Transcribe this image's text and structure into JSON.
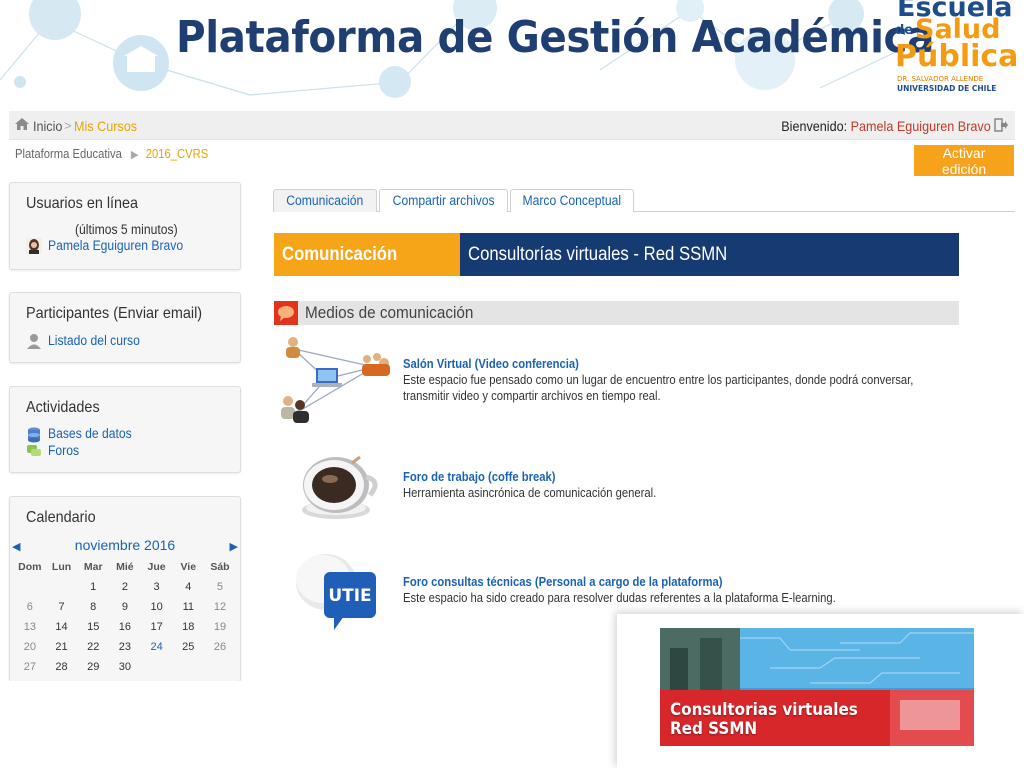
{
  "banner": {
    "title": "Plataforma de Gestión Académica"
  },
  "logo": {
    "escuela": "Escuela",
    "de": "de",
    "salud": "Salud",
    "publica": "Pública",
    "sub1": "DR. SALVADOR ALLENDE",
    "sub2": "UNIVERSIDAD DE CHILE"
  },
  "nav": {
    "home": "Inicio",
    "separator": ">",
    "my_courses": "Mis Cursos",
    "welcome_label": "Bienvenido:",
    "user": "Pamela Eguiguren Bravo"
  },
  "breadcrumb": {
    "root": "Plataforma Educativa",
    "arrow": "▶",
    "course": "2016_CVRS"
  },
  "edit_button": "Activar edición",
  "blocks": {
    "online": {
      "title": "Usuarios en línea",
      "subtitle": "(últimos 5 minutos)",
      "user": "Pamela Eguiguren Bravo"
    },
    "participants": {
      "title": "Participantes (Enviar email)",
      "link": "Listado del curso"
    },
    "activities": {
      "title": "Actividades",
      "items": [
        "Bases de datos",
        "Foros"
      ]
    },
    "calendar": {
      "title": "Calendario",
      "month": "noviembre 2016",
      "prev": "◀",
      "next": "▶",
      "days": [
        "Dom",
        "Lun",
        "Mar",
        "Mié",
        "Jue",
        "Vie",
        "Sáb"
      ],
      "weeks": [
        [
          "",
          "",
          "1",
          "2",
          "3",
          "4",
          "5"
        ],
        [
          "6",
          "7",
          "8",
          "9",
          "10",
          "11",
          "12"
        ],
        [
          "13",
          "14",
          "15",
          "16",
          "17",
          "18",
          "19"
        ],
        [
          "20",
          "21",
          "22",
          "23",
          "24",
          "25",
          "26"
        ],
        [
          "27",
          "28",
          "29",
          "30",
          "",
          "",
          ""
        ]
      ],
      "today": "24"
    }
  },
  "tabs": [
    "Comunicación",
    "Compartir archivos",
    "Marco Conceptual"
  ],
  "section": {
    "label": "Comunicación",
    "title": "Consultorías virtuales - Red SSMN"
  },
  "media": {
    "heading": "Medios de comunicación",
    "items": [
      {
        "title": "Salón Virtual (Video conferencia)",
        "desc": "Este espacio fue pensado como un lugar de encuentro entre los participantes, donde podrá conversar, transmitir video y compartir archivos en tiempo real."
      },
      {
        "title": "Foro de trabajo (coffe break)",
        "desc": "Herramienta asincrónica de comunicación general."
      },
      {
        "title": "Foro consultas técnicas (Personal a cargo de la plataforma)",
        "desc": "Este espacio ha sido creado para resolver dudas referentes a la plataforma E-learning."
      }
    ],
    "utie_label": "UTIE"
  },
  "popup": {
    "line1": "Consultorias virtuales",
    "line2": "Red SSMN"
  },
  "colors": {
    "title_blue": "#1f3f73",
    "orange": "#f6a418",
    "navy": "#163a72",
    "link": "#1a63b4"
  }
}
